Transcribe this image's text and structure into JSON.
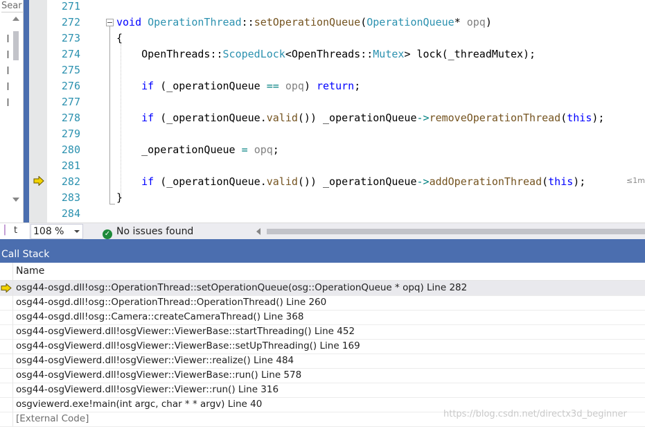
{
  "colors": {
    "accent": "#4b6eaf",
    "line_number": "#2b91af",
    "keyword": "#0000ff",
    "type": "#2b91af",
    "function": "#74531f",
    "breakpoint_arrow": "#f2d300"
  },
  "left_panel": {
    "search_text": "Sear"
  },
  "glyph_margin": {
    "current_line_icon": "current-statement-arrow-icon"
  },
  "editor": {
    "line_numbers": [
      "271",
      "272",
      "273",
      "274",
      "275",
      "276",
      "277",
      "278",
      "279",
      "280",
      "281",
      "282",
      "283",
      "284"
    ],
    "lines": {
      "l272": {
        "kw_void": "void",
        "class": "OperationThread",
        "sep": "::",
        "fn": "setOperationQueue",
        "open": "(",
        "ptype": "OperationQueue",
        "pstar": "*",
        "pname": " opq",
        "close": ")"
      },
      "l273": {
        "text": "{"
      },
      "l274": {
        "ns": "OpenThreads",
        "sep1": "::",
        "cls": "ScopedLock",
        "lt": "<",
        "ns2": "OpenThreads",
        "sep2": "::",
        "cls2": "Mutex",
        "gt": ">",
        "rest1": " ",
        "fn": "lock",
        "rest2": "(_threadMutex);"
      },
      "l276": {
        "kw_if": "if",
        "p1": " (_operationQueue ",
        "op": "==",
        "p2": " ",
        "ph": "opq",
        "p3": ") ",
        "kw_ret": "return",
        "p4": ";"
      },
      "l278": {
        "kw_if": "if",
        "p1": " (_operationQueue.",
        "fn1": "valid",
        "p2": "()) _operationQueue",
        "arrow": "->",
        "fn2": "removeOperationThread",
        "p3": "(",
        "kw_this": "this",
        "p4": ");"
      },
      "l280": {
        "p1": "_operationQueue ",
        "op": "=",
        "p2": " ",
        "ph": "opq",
        "p3": ";"
      },
      "l282": {
        "kw_if": "if",
        "p1": " (_operationQueue.",
        "fn1": "valid",
        "p2": "()) _operationQueue",
        "arrow": "->",
        "fn2": "addOperationThread",
        "p3": "(",
        "kw_this": "this",
        "p4": ");"
      },
      "l283": {
        "text": "}"
      }
    },
    "perf_hint": "≤1m"
  },
  "status_bar": {
    "zoom": "108 %",
    "issues_text": "No issues found"
  },
  "call_stack": {
    "title": "Call Stack",
    "column_name": "Name",
    "rows": [
      "osg44-osgd.dll!osg::OperationThread::setOperationQueue(osg::OperationQueue * opq) Line 282",
      "osg44-osgd.dll!osg::OperationThread::OperationThread() Line 260",
      "osg44-osgd.dll!osg::Camera::createCameraThread() Line 368",
      "osg44-osgViewerd.dll!osgViewer::ViewerBase::startThreading() Line 452",
      "osg44-osgViewerd.dll!osgViewer::ViewerBase::setUpThreading() Line 169",
      "osg44-osgViewerd.dll!osgViewer::Viewer::realize() Line 484",
      "osg44-osgViewerd.dll!osgViewer::ViewerBase::run() Line 578",
      "osg44-osgViewerd.dll!osgViewer::Viewer::run() Line 316",
      "osgviewerd.exe!main(int argc, char * * argv) Line 40",
      "[External Code]"
    ]
  },
  "watermark": "https://blog.csdn.net/directx3d_beginner"
}
